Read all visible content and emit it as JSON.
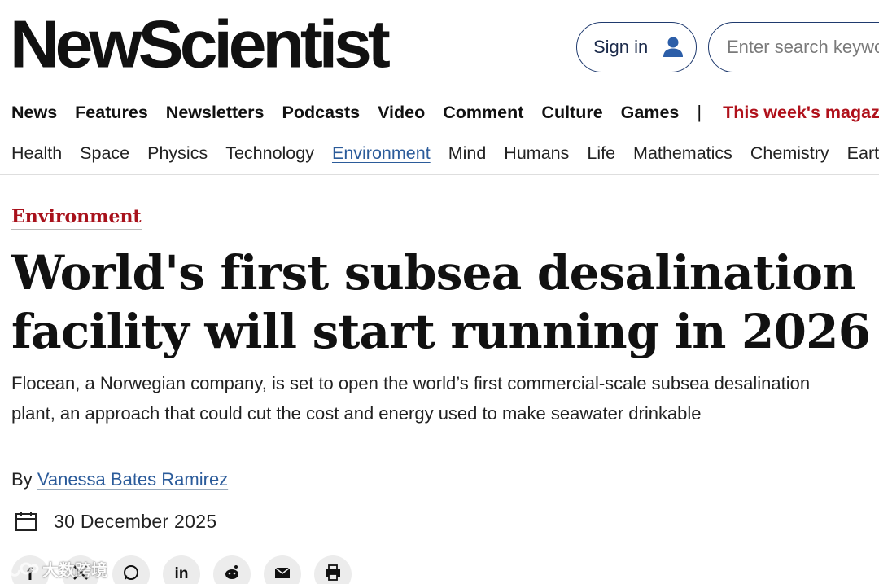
{
  "header": {
    "logo": "NewScientist",
    "signin_label": "Sign in",
    "search_placeholder": "Enter search keywords"
  },
  "main_nav": {
    "items": [
      "News",
      "Features",
      "Newsletters",
      "Podcasts",
      "Video",
      "Comment",
      "Culture",
      "Games"
    ],
    "separator": "|",
    "magazine": "This week's magazine",
    "magazine_color": "#b0111b"
  },
  "sub_nav": {
    "items": [
      "Health",
      "Space",
      "Physics",
      "Technology",
      "Environment",
      "Mind",
      "Humans",
      "Life",
      "Mathematics",
      "Chemistry",
      "Earth"
    ],
    "active": "Environment"
  },
  "article": {
    "category": "Environment",
    "headline": "World's first subsea desalination facility will start running in 2026",
    "standfirst": "Flocean, a Norwegian company, is set to open the world’s first commercial-scale subsea desalination plant, an approach that could cut the cost and energy used to make seawater drinkable",
    "by_label": "By",
    "author": "Vanessa Bates Ramirez",
    "date": "30 December 2025"
  },
  "share": {
    "buttons": [
      {
        "icon": "facebook-icon",
        "glyph": "f"
      },
      {
        "icon": "x-icon",
        "glyph": "𝕏"
      },
      {
        "icon": "whatsapp-icon",
        "glyph": "wa"
      },
      {
        "icon": "linkedin-icon",
        "glyph": "in"
      },
      {
        "icon": "reddit-icon",
        "glyph": "r"
      },
      {
        "icon": "email-icon",
        "glyph": "✉"
      },
      {
        "icon": "print-icon",
        "glyph": "⎙"
      }
    ]
  },
  "watermark": {
    "text": "大数跨境"
  },
  "colors": {
    "accent_red": "#a8111b",
    "link_blue": "#2b5b9a",
    "border_navy": "#1f3a6e"
  }
}
